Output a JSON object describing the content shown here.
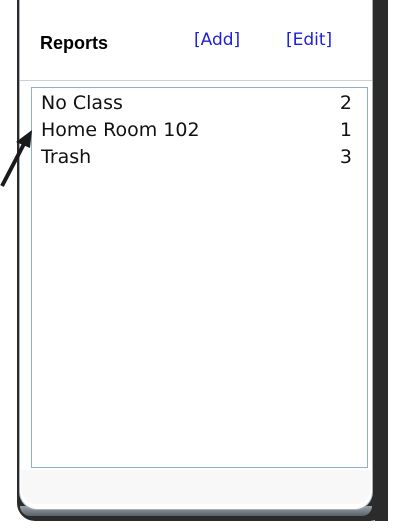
{
  "header": {
    "title": "Reports",
    "add_label": "[Add]",
    "edit_label": "[Edit]"
  },
  "list": {
    "items": [
      {
        "name": "No Class",
        "count": "2"
      },
      {
        "name": "Home Room 102",
        "count": "1"
      },
      {
        "name": "Trash",
        "count": "3"
      }
    ]
  },
  "colors": {
    "link": "#2020d8",
    "frame": "#2b2b2b",
    "list_border": "#8fb0cc"
  },
  "icons": {
    "pointer": "arrow-pointer-icon"
  }
}
